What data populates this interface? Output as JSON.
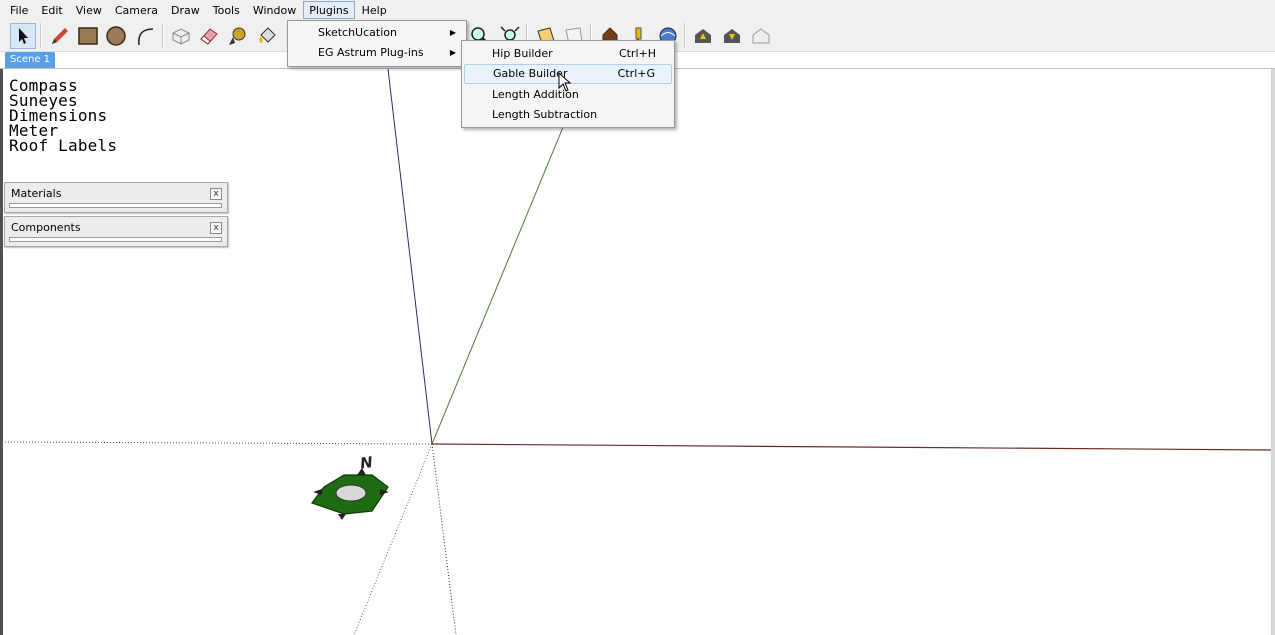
{
  "menubar": {
    "items": [
      "File",
      "Edit",
      "View",
      "Camera",
      "Draw",
      "Tools",
      "Window",
      "Plugins",
      "Help"
    ],
    "open_item": "Plugins"
  },
  "toolbar": {
    "tools": [
      "select-icon",
      "pencil-icon",
      "rectangle-icon",
      "circle-icon",
      "arc-icon",
      "make-component-icon",
      "eraser-icon",
      "tape-measure-icon",
      "paint-bucket-icon",
      "zoom-icon",
      "zoom-extents-icon",
      "section-plane-icon",
      "fog-icon",
      "house-walk-icon",
      "pushpin-icon",
      "globe-icon",
      "upload-icon",
      "download-icon",
      "warehouse-icon"
    ]
  },
  "scene_tab": {
    "label": "Scene 1"
  },
  "layers": [
    "Compass",
    "Suneyes",
    "Dimensions",
    "Meter",
    "Roof Labels"
  ],
  "trays": [
    {
      "title": "Materials",
      "close": "x"
    },
    {
      "title": "Components",
      "close": "x"
    }
  ],
  "plugins_menu": {
    "items": [
      {
        "label": "SketchUcation",
        "submenu": true
      },
      {
        "label": "EG Astrum Plug-ins",
        "submenu": true
      }
    ]
  },
  "eg_astrum_menu": {
    "items": [
      {
        "label": "Hip Builder",
        "shortcut": "Ctrl+H"
      },
      {
        "label": "Gable Builder",
        "shortcut": "Ctrl+G",
        "hovered": true
      },
      {
        "label": "Length Addition",
        "shortcut": ""
      },
      {
        "label": "Length Subtraction",
        "shortcut": ""
      }
    ]
  },
  "compass": {
    "north_label": "N"
  },
  "colors": {
    "menu_open_bg": "#e5eef8",
    "scene_tab": "#58a0e6",
    "axis_red": "#6b2a2a",
    "axis_green": "#4f7a3a",
    "axis_blue": "#2a2a6b",
    "compass_green": "#1f6b12"
  }
}
